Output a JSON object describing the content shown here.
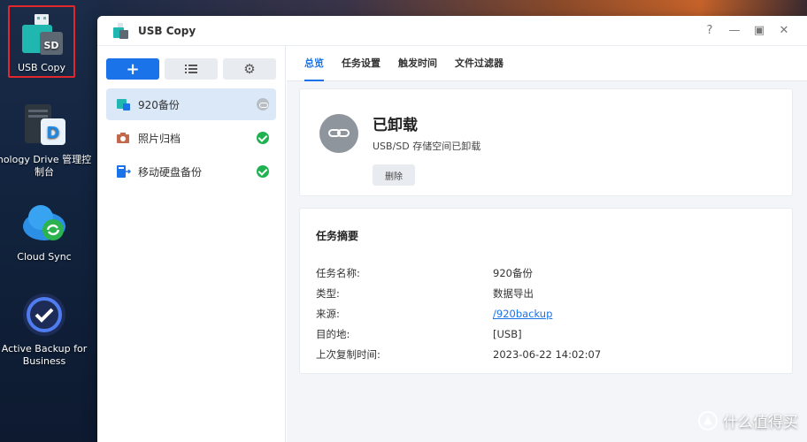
{
  "desktop": {
    "icons": [
      {
        "label": "USB Copy"
      },
      {
        "label": "nology Drive 管理控制台"
      },
      {
        "label": "Cloud Sync"
      },
      {
        "label": "Active Backup for Business"
      }
    ]
  },
  "window": {
    "title": "USB Copy",
    "controls": {
      "help": "?",
      "minimize": "—",
      "maximize": "▣",
      "close": "✕"
    }
  },
  "sidebar": {
    "tasks": [
      {
        "label": "920备份",
        "status": "unmounted"
      },
      {
        "label": "照片归档",
        "status": "ok"
      },
      {
        "label": "移动硬盘备份",
        "status": "ok"
      }
    ]
  },
  "tabs": [
    "总览",
    "任务设置",
    "触发时间",
    "文件过滤器"
  ],
  "status_card": {
    "title": "已卸载",
    "description": "USB/SD 存储空间已卸载",
    "delete_label": "删除"
  },
  "summary": {
    "title": "任务摘要",
    "rows": [
      {
        "key": "任务名称:",
        "value": "920备份"
      },
      {
        "key": "类型:",
        "value": "数据导出"
      },
      {
        "key": "来源:",
        "value": "/920backup"
      },
      {
        "key": "目的地:",
        "value": "[USB]"
      },
      {
        "key": "上次复制时间:",
        "value": "2023-06-22 14:02:07"
      }
    ]
  },
  "watermark": "什么值得买",
  "colors": {
    "accent": "#1a73e8",
    "ok": "#1eb251",
    "selection_border": "#e0282c"
  }
}
